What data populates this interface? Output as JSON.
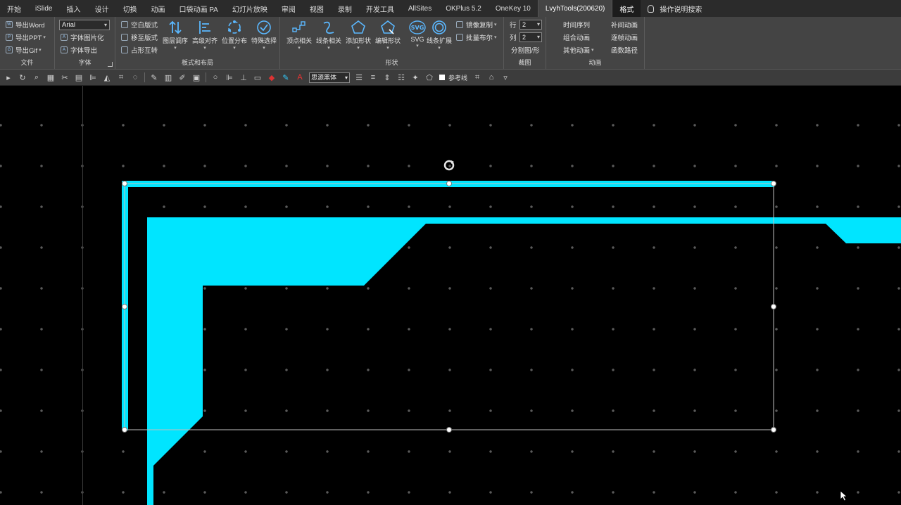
{
  "tabs": [
    "开始",
    "iSlide",
    "插入",
    "设计",
    "切换",
    "动画",
    "口袋动画 PA",
    "幻灯片放映",
    "审阅",
    "视图",
    "录制",
    "开发工具",
    "AllSites",
    "OKPlus 5.2",
    "OneKey 10",
    "LvyhTools(200620)",
    "格式",
    "操作说明搜索"
  ],
  "ribbon": {
    "file": {
      "label": "文件",
      "export_word": "导出Word",
      "export_ppt": "导出PPT",
      "export_gif": "导出Gif"
    },
    "font": {
      "label": "字体",
      "font_name": "Arial",
      "font_to_image": "字体图片化",
      "font_export": "字体导出"
    },
    "layout": {
      "label": "板式和布局",
      "blank_layout": "空白版式",
      "move_layout": "移至版式",
      "placeholder_swap": "占形互转",
      "layer_order": "图层调序",
      "advanced_align": "高级对齐",
      "position_distribute": "位置分布",
      "special_select": "特殊选择"
    },
    "shape": {
      "label": "形状",
      "vertex": "顶点相关",
      "line": "线条相关",
      "add_shape": "添加形状",
      "edit_shape": "编辑形状",
      "svg": "SVG",
      "line_expand": "线条扩展",
      "mirror_copy": "镜像复制",
      "batch_boolean": "批量布尔"
    },
    "crop": {
      "label": "裁图",
      "row_label": "行",
      "row_value": "2",
      "col_label": "列",
      "col_value": "2",
      "split_image": "分割图/形"
    },
    "animation": {
      "label": "动画",
      "timeline": "时间序列",
      "tween": "补间动画",
      "combine": "组合动画",
      "frame_by_frame": "逐帧动画",
      "other": "其他动画",
      "function_path": "函数路径"
    }
  },
  "toolbar": {
    "font": "思源黑体",
    "guide_label": "参考线"
  },
  "colors": {
    "accent": "#00e5ff",
    "canvas": "#000000",
    "ribbon": "#444444",
    "tabbar": "#2b2b2b",
    "grid_dot": "#5a5a5a"
  }
}
